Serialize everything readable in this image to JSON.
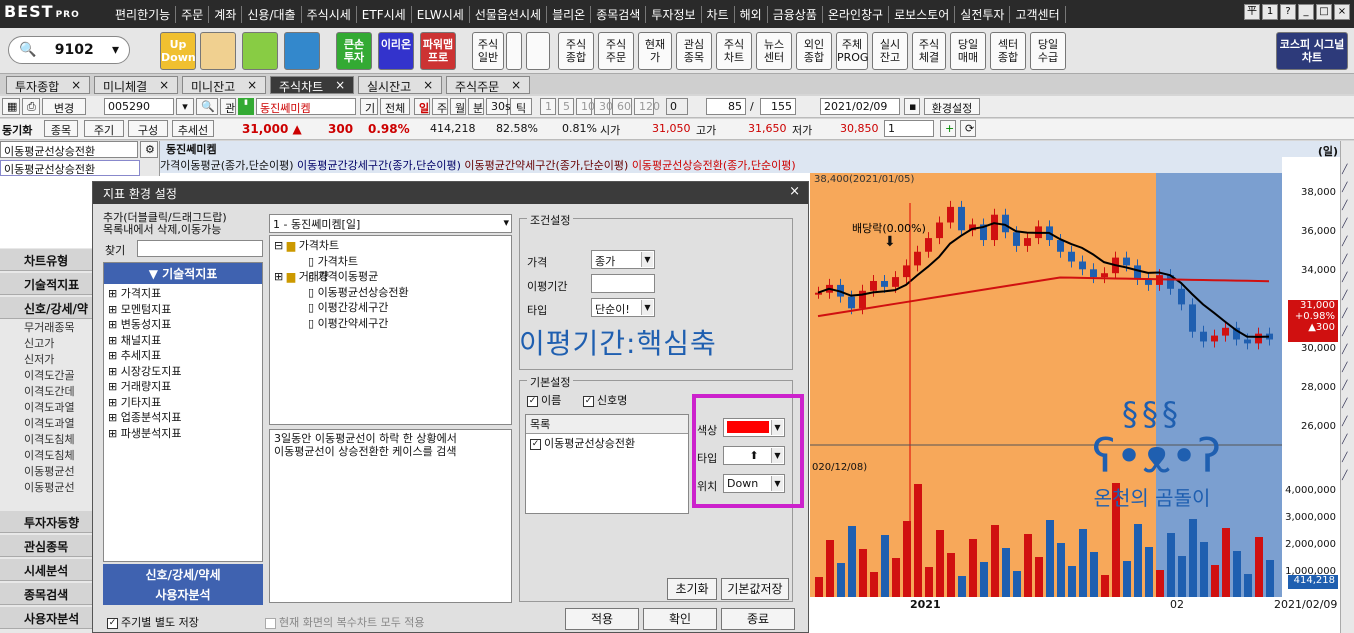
{
  "app": {
    "logo": "BEST",
    "logo_sub": "PRO"
  },
  "menu": [
    "편리한기능",
    "주문",
    "계좌",
    "신용/대출",
    "주식시세",
    "ETF시세",
    "ELW시세",
    "선물옵션시세",
    "블리온",
    "종목검색",
    "투자정보",
    "차트",
    "해외",
    "금융상품",
    "온라인창구",
    "로보스토어",
    "실전투자",
    "고객센터"
  ],
  "window_buttons": [
    "平",
    "1",
    "?",
    "_",
    "□",
    "×"
  ],
  "toolbar": {
    "code": "9102",
    "buttons": [
      {
        "label": "Up\nDown",
        "color": "#f0c030"
      },
      {
        "label": "",
        "color": "#f0d090"
      },
      {
        "label": "",
        "color": "#8c4"
      },
      {
        "label": "",
        "color": "#38c"
      },
      {
        "label": "큰손\n투자",
        "color": "#3a3"
      },
      {
        "label": "이리온",
        "color": "#33c"
      },
      {
        "label": "파워맵\n프로",
        "color": "#c33"
      },
      {
        "label": "주식\n일반",
        "color": "#fafafa"
      },
      {
        "label": "",
        "color": "#fafafa"
      },
      {
        "label": "",
        "color": "#fafafa"
      },
      {
        "label": "주식\n종합",
        "color": "#fafafa"
      },
      {
        "label": "주식\n주문",
        "color": "#fafafa"
      },
      {
        "label": "현재\n가",
        "color": "#fafafa"
      },
      {
        "label": "관심\n종목",
        "color": "#fafafa"
      },
      {
        "label": "주식\n차트",
        "color": "#fafafa"
      },
      {
        "label": "뉴스\n센터",
        "color": "#fafafa"
      },
      {
        "label": "외인\n종합",
        "color": "#fafafa"
      },
      {
        "label": "주체\nPROG",
        "color": "#fafafa"
      },
      {
        "label": "실시\n잔고",
        "color": "#fafafa"
      },
      {
        "label": "주식\n체결",
        "color": "#fafafa"
      },
      {
        "label": "당일\n매매",
        "color": "#fafafa"
      },
      {
        "label": "섹터\n종합",
        "color": "#fafafa"
      },
      {
        "label": "당일\n수급",
        "color": "#fafafa"
      }
    ],
    "kospi": "코스피\n시그널차트"
  },
  "tabs": [
    {
      "label": "투자종합",
      "active": false
    },
    {
      "label": "미니체결",
      "active": false
    },
    {
      "label": "미니잔고",
      "active": false
    },
    {
      "label": "주식차트",
      "active": true
    },
    {
      "label": "실시잔고",
      "active": false
    },
    {
      "label": "주식주문",
      "active": false
    }
  ],
  "bar2": {
    "change": "변경",
    "code": "005290",
    "kwan": "관",
    "stock": "동진쎄미켐",
    "gi": "기",
    "all": "전체",
    "periods": [
      "일",
      "주",
      "월",
      "분",
      "30s",
      "틱"
    ],
    "nums": [
      "1",
      "5",
      "10",
      "30",
      "60",
      "120"
    ],
    "zero": "0",
    "count": "85",
    "total": "155",
    "date": "2021/02/09",
    "settings": "환경설정"
  },
  "bar3": {
    "sync": "동기화",
    "item": "종목",
    "period": "주기",
    "config": "구성",
    "trend": "추세선",
    "price": "31,000 ▲",
    "change": "300",
    "rate": "0.98%",
    "volume": "414,218",
    "p1": "82.58%",
    "p2": "0.81%",
    "open_lbl": "시가",
    "open": "31,050",
    "high_lbl": "고가",
    "high": "31,650",
    "low_lbl": "저가",
    "low": "30,850",
    "box": "1"
  },
  "left": {
    "search_value": "이동평균선상승전환",
    "selected": "이동평균선상승전환",
    "sections": [
      "차트유형",
      "기술적지표",
      "신호/강세/약"
    ],
    "items": [
      "무거래종목",
      "신고가",
      "신저가",
      "이격도간골",
      "이격도간데",
      "이격도과열",
      "이격도과열",
      "이격도침체",
      "이격도침체",
      "이동평균선",
      "이동평균선"
    ],
    "bottom": [
      "투자자동향",
      "관심종목",
      "시세분석",
      "종목검색",
      "사용자분석"
    ]
  },
  "chart": {
    "title": "동진쎄미켐",
    "legend": [
      "가격이동평균(종가,단순이평)",
      "이동평균간강세구간(종가,",
      "단순이평)",
      "이동평균간약세구간(종가,",
      "단순이평)",
      "이동평균선상승전환(종가,",
      "단순이평)"
    ],
    "period_tag": "(일)",
    "high_note": "38,400(2021/01/05)",
    "div_note": "배당락(0.00%)",
    "prev_note": "020/12/08)",
    "yticks": [
      "38,000",
      "36,000",
      "34,000",
      "32,000",
      "30,000",
      "28,000",
      "26,000"
    ],
    "vticks": [
      "4,000,000",
      "3,000,000",
      "2,000,000",
      "1,000,000"
    ],
    "price_tag": [
      "31,000",
      "+0.98%",
      "▲300"
    ],
    "vol_tag": "414,218",
    "x_labels": [
      "2021",
      "02",
      "2021/02/09"
    ],
    "watermark": "온천의 곰돌이"
  },
  "dialog": {
    "title": "지표 환경 설정",
    "hint": "추가(더블클릭/드래그드랍)\n목록내에서 삭제,이동가능",
    "search_label": "찾기",
    "tech_header": "기술적지표",
    "categories": [
      "가격지표",
      "모멘텀지표",
      "변동성지표",
      "채널지표",
      "추세지표",
      "시장강도지표",
      "거래량지표",
      "기타지표",
      "업종분석지표",
      "파생분석지표"
    ],
    "signal_header": "신호/강세/약세",
    "user_header": "사용자분석",
    "combo": "1 - 동진쎄미켐[일]",
    "tree_root": "가격차트",
    "tree_items": [
      "가격차트",
      "가격이동평균",
      "이동평균선상승전환",
      "이평간강세구간",
      "이평간약세구간"
    ],
    "tree_volume": "거래량",
    "description": "3일동안 이동평균선이 하락 한 상황에서\n이동평균선이 상승전환한 케이스를 검색",
    "cond_title": "조건설정",
    "price_lbl": "가격",
    "price_val": "종가",
    "period_lbl": "이평기간",
    "type_lbl": "타입",
    "type_val": "단순이!",
    "big_text": "이평기간:핵심축",
    "basic_title": "기본설정",
    "chk_name": "이름",
    "chk_signal": "신호명",
    "list_header": "목록",
    "list_item": "이동평균선상승전환",
    "color_lbl": "색상",
    "shape_lbl": "타입",
    "pos_lbl": "위치",
    "pos_val": "Down",
    "init_btn": "초기화",
    "default_btn": "기본값저장",
    "save_period": "주기별 별도 저장",
    "apply_all": "현재 화면의 복수차트 모두 적용",
    "apply": "적용",
    "ok": "확인",
    "close": "종료",
    "color_value": "#ff0000"
  }
}
